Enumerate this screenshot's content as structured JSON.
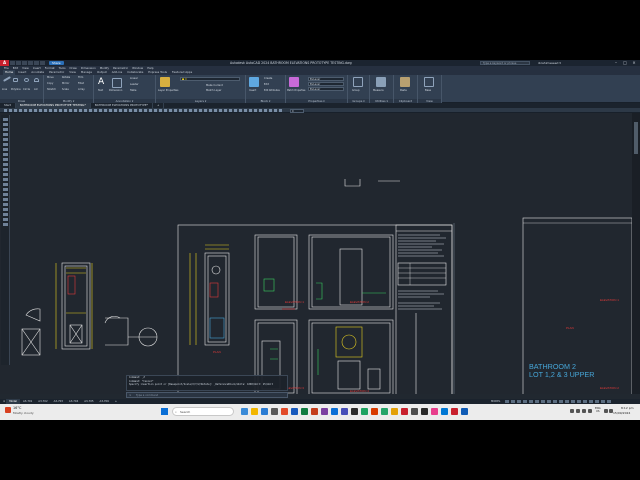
{
  "titlebar": {
    "share": "Share",
    "title": "Autodesk AutoCAD 2024  BATHROOM ELEVATIONS PROTOTYPE TESTING.dwg",
    "search_placeholder": "Type a keyword or phrase",
    "user": "ibrahimsaeed ▾"
  },
  "menubar": [
    "File",
    "Edit",
    "View",
    "Insert",
    "Format",
    "Tools",
    "Draw",
    "Dimension",
    "Modify",
    "Parametric",
    "Window",
    "Help"
  ],
  "ribbon_tabs": [
    "Home",
    "Insert",
    "Annotate",
    "Parametric",
    "View",
    "Manage",
    "Output",
    "Add-ins",
    "Collaborate",
    "Express Tools",
    "Featured Apps"
  ],
  "ribbon": {
    "draw": {
      "title": "Draw",
      "line": "Line",
      "polyline": "Polyline",
      "circle": "Circle",
      "arc": "Arc"
    },
    "modify": {
      "title": "Modify ▾",
      "move": "Move",
      "rotate": "Rotate",
      "trim": "Trim",
      "copy": "Copy",
      "mirror": "Mirror",
      "fillet": "Fillet",
      "stretch": "Stretch",
      "scale": "Scale",
      "array": "Array"
    },
    "annotation": {
      "title": "Annotation ▾",
      "text": "Text",
      "dimension": "Dimension",
      "linear": "Linear",
      "leader": "Leader",
      "table": "Table"
    },
    "layers": {
      "title": "Layers ▾",
      "layer_props": "Layer Properties",
      "make_current": "Make Current",
      "match_layer": "Match Layer"
    },
    "block": {
      "title": "Block ▾",
      "insert": "Insert",
      "create": "Create",
      "edit": "Edit",
      "edit_attrs": "Edit Attributes"
    },
    "properties": {
      "title": "Properties ▾",
      "match": "Match Properties",
      "bylayer": "ByLayer",
      "bylayer2": "ByLayer",
      "bylayer3": "ByLayer"
    },
    "groups": {
      "title": "Groups ▾",
      "group": "Group"
    },
    "utilities": {
      "title": "Utilities ▾",
      "measure": "Measure"
    },
    "clipboard": {
      "title": "Clipboard",
      "paste": "Paste"
    },
    "view": {
      "title": "View",
      "base": "Base"
    }
  },
  "file_tabs": [
    "Start",
    "BATHROOM ELEVATIONS PROTOTYPE TESTING*",
    "BATHROOM ELEVATIONS PROTOTYPE*",
    "+"
  ],
  "layer_combo": "0",
  "drawing": {
    "bathroom_label_1": "BATHROOM 2",
    "bathroom_label_2": "LOT 1,2 & 3 UPPER",
    "plan_label": "PLAN",
    "plan_label_right": "PLAN",
    "elev_1": "ELEVATION 1",
    "elev_2": "ELEVATION 2",
    "elev_3": "ELEVATION 3",
    "elev_4": "ELEVATION 4",
    "elev_right_1": "ELEVATION 1",
    "elev_right_2": "ELEVATION 2"
  },
  "command": {
    "history": [
      "Command: _Z",
      "Command: *Cancel*",
      "Specify insertion point or [Basepoint/Scale/X/Y/Z/Rotate]: _ReferenceBlock/Units: 1000/Unit: 25/Unit"
    ],
    "prompt": "Type a command"
  },
  "layout_tabs": [
    "Model",
    "A3-701",
    "A3-702",
    "A3-703",
    "A3-704",
    "A3-705",
    "A3-706",
    "+"
  ],
  "status": {
    "model": "MODEL"
  },
  "taskbar": {
    "temp": "16°C",
    "weather": "Mostly cloudy",
    "search": "Search",
    "lang1": "ENG",
    "lang2": "US",
    "time": "8:12 pm",
    "date": "15/09/2024"
  },
  "colors": {
    "drawing_bg": "#21272f",
    "line_white": "#e6e6e6",
    "line_yellow": "#e8d020",
    "line_green": "#38d060",
    "line_red": "#e23a3a",
    "accent_cyan": "#46a6d8"
  }
}
